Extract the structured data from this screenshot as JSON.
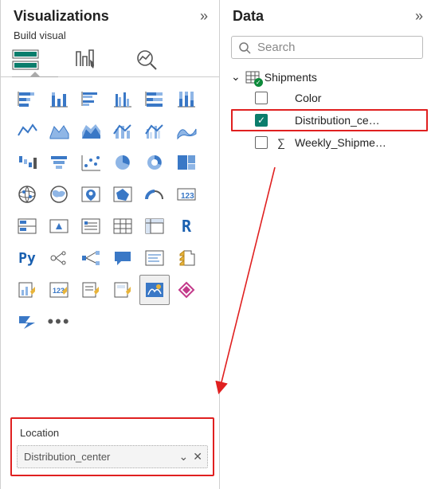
{
  "panes": {
    "viz_title": "Visualizations",
    "build_label": "Build visual",
    "data_title": "Data"
  },
  "search": {
    "placeholder": "Search"
  },
  "field_well": {
    "label": "Location",
    "value": "Distribution_center"
  },
  "table": {
    "name": "Shipments",
    "fields": [
      {
        "label": "Color",
        "checked": false,
        "sigma": false,
        "selected": false
      },
      {
        "label": "Distribution_ce…",
        "checked": true,
        "sigma": false,
        "selected": true
      },
      {
        "label": "Weekly_Shipme…",
        "checked": false,
        "sigma": true,
        "selected": false
      }
    ]
  },
  "viz_types": [
    "stacked-bar",
    "stacked-column",
    "clustered-bar",
    "clustered-column",
    "100-stacked-bar",
    "100-stacked-column",
    "line",
    "area",
    "stacked-area",
    "line-stacked-column",
    "line-clustered-column",
    "ribbon",
    "waterfall",
    "funnel",
    "scatter",
    "pie",
    "donut",
    "treemap",
    "map",
    "filled-map",
    "azure-map",
    "shape-map",
    "gauge",
    "card",
    "multi-row-card",
    "kpi",
    "slicer",
    "table",
    "matrix",
    "r-visual",
    "python-visual",
    "key-influencers",
    "decomposition-tree",
    "qna",
    "smart-narrative",
    "paginated-report",
    "power-apps",
    "arcgis",
    "power-automate",
    "arcgis-2",
    "arcgis-map",
    "get-more-visuals",
    "automate",
    "more-options"
  ],
  "selected_viz": "arcgis-map"
}
